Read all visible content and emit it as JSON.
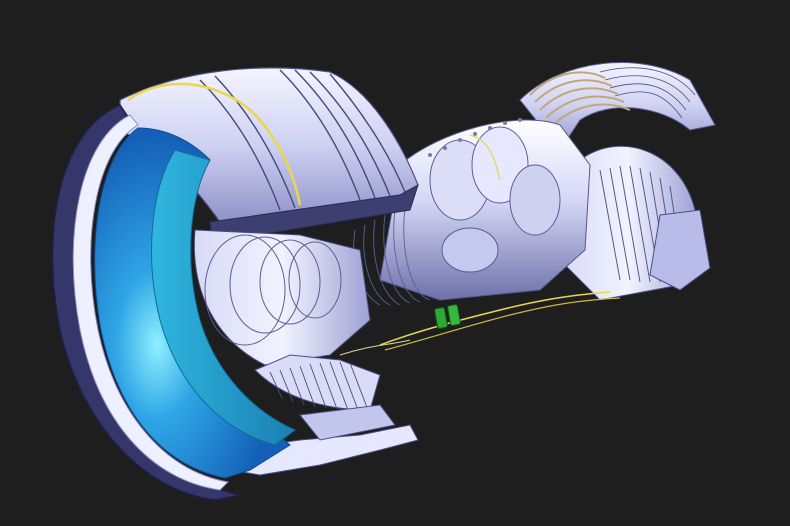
{
  "scene": {
    "subject": "turbofan-engine-cutaway",
    "colors": {
      "background": "#1e1e1e",
      "metal_light": "#eef0ff",
      "metal_mid": "#c9ccf0",
      "metal_dark": "#7d80b8",
      "metal_shadow": "#3a3c6a",
      "intake_blue_outer": "#1b7fd6",
      "intake_blue_inner": "#2fb2e8",
      "intake_highlight": "#7fe6ff",
      "wire_yellow": "#e8d84a",
      "connector_green": "#2fa836",
      "bronze_band": "#c2a878"
    }
  }
}
